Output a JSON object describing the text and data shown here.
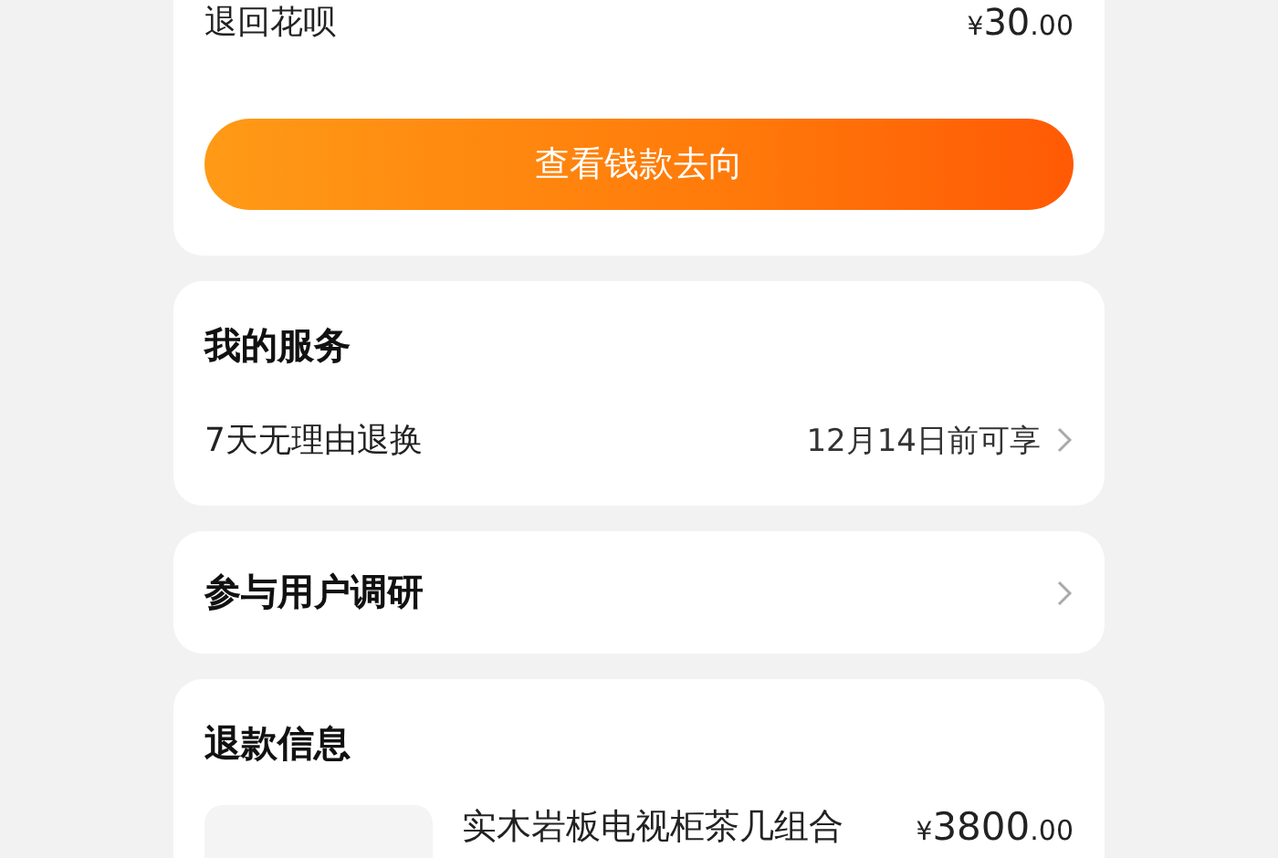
{
  "refund_summary": {
    "label": "退回花呗",
    "amount": "¥30.00",
    "button": "查看钱款去向"
  },
  "services": {
    "title": "我的服务",
    "items": [
      {
        "label": "7天无理由退换",
        "detail": "12月14日前可享"
      }
    ]
  },
  "survey": {
    "label": "参与用户调研"
  },
  "refund_info": {
    "title": "退款信息",
    "product": {
      "name": "实木岩板电视柜茶几组合",
      "price": "¥3800.00"
    }
  }
}
